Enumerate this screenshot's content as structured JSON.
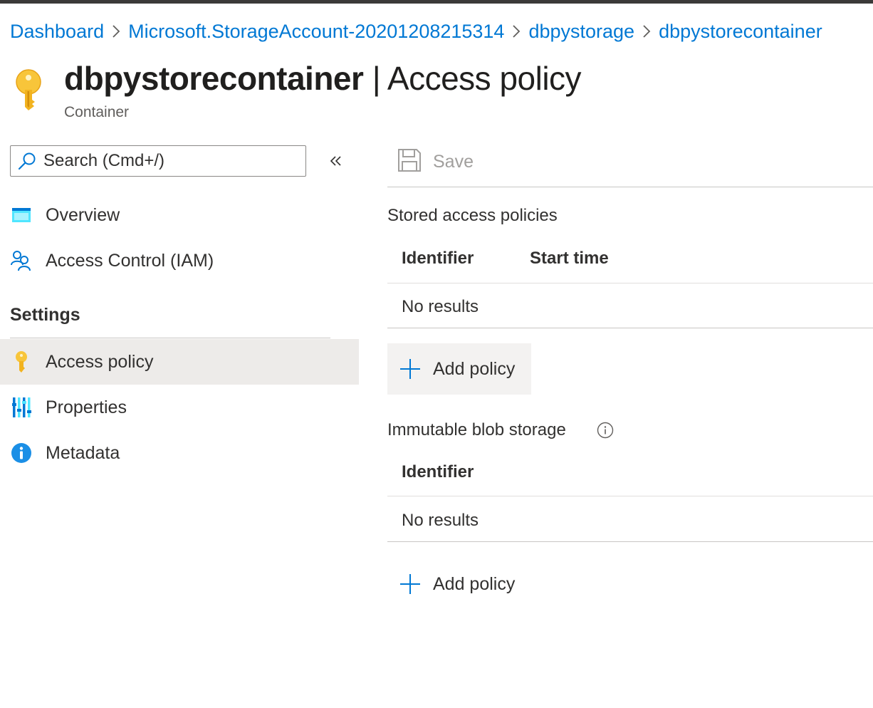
{
  "breadcrumb": {
    "items": [
      "Dashboard",
      "Microsoft.StorageAccount-20201208215314",
      "dbpystorage",
      "dbpystorecontainer"
    ]
  },
  "header": {
    "resource_name": "dbpystorecontainer",
    "separator": " | ",
    "page_name": "Access policy",
    "subtitle": "Container",
    "icon": "key-icon"
  },
  "sidebar": {
    "search_placeholder": "Search (Cmd+/)",
    "collapse_icon": "double-chevron-left-icon",
    "items": [
      {
        "label": "Overview",
        "icon": "overview-icon"
      },
      {
        "label": "Access Control (IAM)",
        "icon": "people-icon"
      }
    ],
    "settings_heading": "Settings",
    "settings_items": [
      {
        "label": "Access policy",
        "icon": "key-icon",
        "selected": true
      },
      {
        "label": "Properties",
        "icon": "properties-icon"
      },
      {
        "label": "Metadata",
        "icon": "info-icon"
      }
    ]
  },
  "toolbar": {
    "save_label": "Save",
    "save_icon": "save-icon",
    "save_enabled": false
  },
  "stored_access_policies": {
    "title": "Stored access policies",
    "columns": [
      "Identifier",
      "Start time"
    ],
    "empty_text": "No results",
    "add_label": "Add policy"
  },
  "immutable_blob_storage": {
    "title": "Immutable blob storage",
    "columns": [
      "Identifier"
    ],
    "empty_text": "No results",
    "add_label": "Add policy"
  },
  "colors": {
    "accent": "#0078d4",
    "key_yellow": "#f8c53a",
    "selected_bg": "#edebe9",
    "button_bg": "#f3f2f1"
  }
}
